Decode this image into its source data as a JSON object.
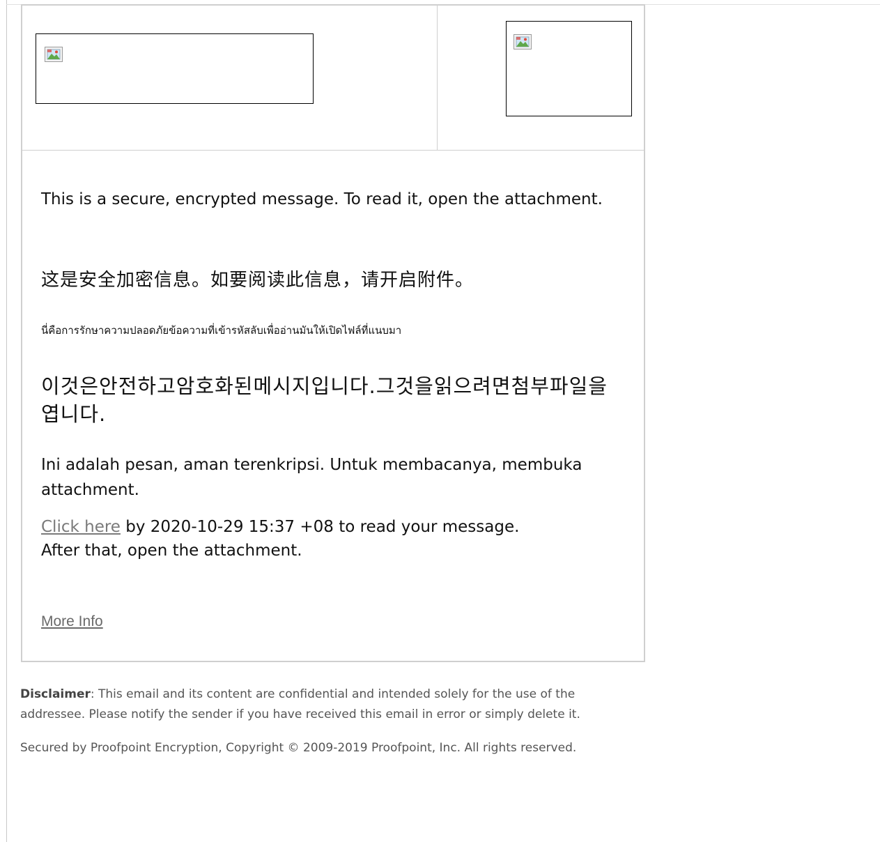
{
  "header": {
    "left_image": {
      "icon": "broken-image-icon"
    },
    "right_image": {
      "icon": "broken-image-icon"
    }
  },
  "body": {
    "english_message": "This is a secure, encrypted message. To read it, open the attachment.",
    "chinese_message": "这是安全加密信息。如要阅读此信息，请开启附件。",
    "thai_message": "นี่คือการรักษาความปลอดภัยข้อความที่เข้ารหัสลับเพื่ออ่านมันให้เปิดไฟล์ที่แนบมา",
    "korean_message": "이것은안전하고암호화된메시지입니다.그것을읽으려면첨부파일을엽니다.",
    "indonesian_message": "Ini adalah pesan, aman terenkripsi. Untuk membacanya, membuka attachment.",
    "cta": {
      "link_text": "Click here",
      "after_link": " by 2020-10-29 15:37 +08 to read your message.",
      "line2": "After that, open the attachment."
    },
    "more_info_link": "More Info"
  },
  "footer": {
    "disclaimer_label": "Disclaimer",
    "disclaimer_text": ": This email and its content are confidential and intended solely for the use of the addressee. Please notify the sender if you have received this email in error or simply delete it.",
    "copyright": "Secured by Proofpoint Encryption, Copyright © 2009-2019 Proofpoint, Inc. All rights reserved."
  },
  "colors": {
    "border": "#cfcfcf",
    "link": "#7a7a7a",
    "footer_text": "#555555"
  }
}
